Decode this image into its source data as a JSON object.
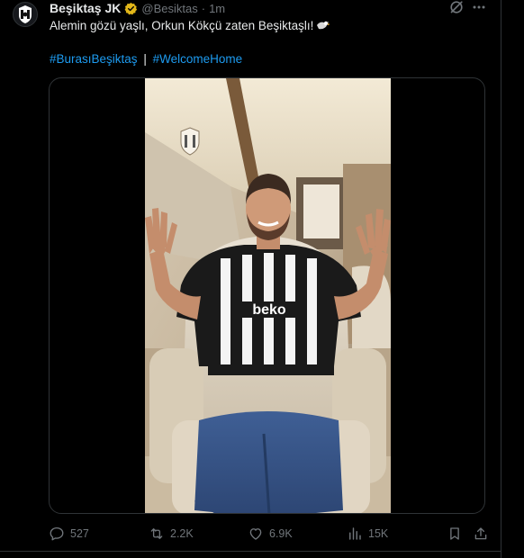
{
  "author": {
    "display_name": "Beşiktaş JK",
    "handle": "@Besiktas",
    "separator": "·",
    "time": "1m",
    "verified_color": "#e2b719"
  },
  "tweet": {
    "text": "Alemin gözü yaşlı, Orkun Kökçü zaten Beşiktaşlı!",
    "emoji": "eagle-emoji",
    "hashtags": [
      "#BurasıBeşiktaş",
      "#WelcomeHome"
    ],
    "hashtag_separator": "|"
  },
  "media": {
    "type": "video",
    "jersey_sponsor": "beko"
  },
  "actions": {
    "replies": "527",
    "reposts": "2.2K",
    "likes": "6.9K",
    "views": "15K"
  },
  "colors": {
    "background": "#000000",
    "text": "#e7e9ea",
    "muted": "#71767b",
    "link": "#1d9bf0",
    "border": "#2f3336"
  }
}
